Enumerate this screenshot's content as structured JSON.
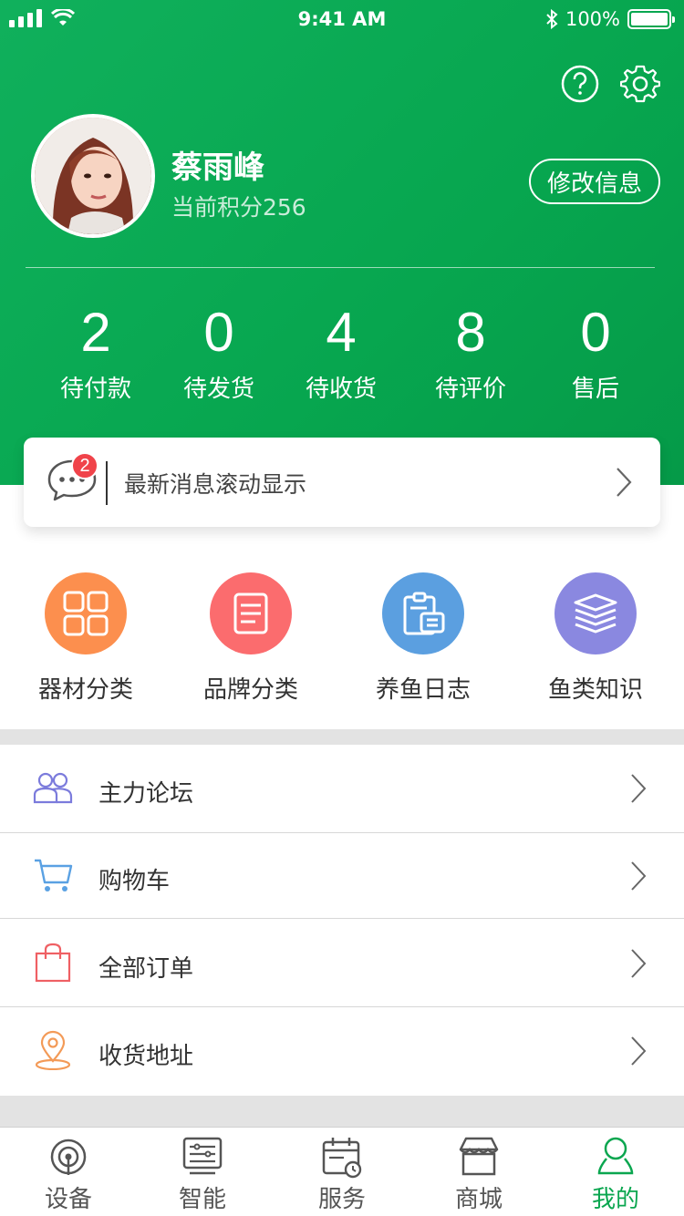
{
  "status_bar": {
    "time": "9:41 AM",
    "battery": "100%"
  },
  "profile": {
    "name": "蔡雨峰",
    "points": "当前积分256",
    "edit_label": "修改信息"
  },
  "order_stats": [
    {
      "count": "2",
      "label": "待付款"
    },
    {
      "count": "0",
      "label": "待发货"
    },
    {
      "count": "4",
      "label": "待收货"
    },
    {
      "count": "8",
      "label": "待评价"
    },
    {
      "count": "0",
      "label": "售后"
    }
  ],
  "message": {
    "badge": "2",
    "text": "最新消息滚动显示"
  },
  "categories": [
    {
      "label": "器材分类",
      "color": "#fc8f4e",
      "icon": "grid-icon"
    },
    {
      "label": "品牌分类",
      "color": "#fb6c6e",
      "icon": "list-doc-icon"
    },
    {
      "label": "养鱼日志",
      "color": "#5b9fe0",
      "icon": "clipboard-icon"
    },
    {
      "label": "鱼类知识",
      "color": "#8a88e0",
      "icon": "book-stack-icon"
    }
  ],
  "menu": [
    {
      "label": "主力论坛",
      "icon": "people-icon",
      "color": "#7b7bdc"
    },
    {
      "label": "购物车",
      "icon": "cart-icon",
      "color": "#5aa1e3"
    },
    {
      "label": "全部订单",
      "icon": "bag-icon",
      "color": "#ef6064"
    },
    {
      "label": "收货地址",
      "icon": "location-icon",
      "color": "#f39a57"
    }
  ],
  "tabs": [
    {
      "label": "设备",
      "icon": "device-icon",
      "active": false
    },
    {
      "label": "智能",
      "icon": "smart-icon",
      "active": false
    },
    {
      "label": "服务",
      "icon": "service-icon",
      "active": false
    },
    {
      "label": "商城",
      "icon": "store-icon",
      "active": false
    },
    {
      "label": "我的",
      "icon": "profile-icon",
      "active": true
    }
  ],
  "colors": {
    "brand": "#07a64f",
    "badge": "#f0434a"
  }
}
